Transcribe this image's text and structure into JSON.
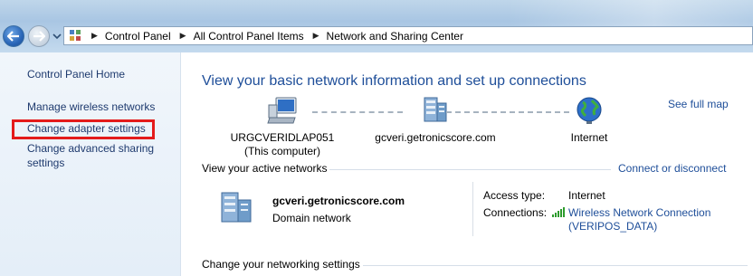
{
  "address_bar": {
    "breadcrumbs": [
      "Control Panel",
      "All Control Panel Items",
      "Network and Sharing Center"
    ],
    "separator": "▶"
  },
  "sidebar": {
    "home": "Control Panel Home",
    "items": [
      {
        "label": "Manage wireless networks"
      },
      {
        "label": "Change adapter settings"
      },
      {
        "label": "Change advanced sharing settings"
      }
    ]
  },
  "main": {
    "heading": "View your basic network information and set up connections",
    "see_full_map": "See full map",
    "map_nodes": [
      {
        "line1": "URGCVERIDLAP051",
        "line2": "(This computer)",
        "icon": "computer-icon"
      },
      {
        "line1": "gcveri.getronicscore.com",
        "line2": "",
        "icon": "network-icon"
      },
      {
        "line1": "Internet",
        "line2": "",
        "icon": "globe-icon"
      }
    ],
    "active_networks_title": "View your active networks",
    "connect_disconnect": "Connect or disconnect",
    "network": {
      "name": "gcveri.getronicscore.com",
      "type": "Domain network",
      "access_type_label": "Access type:",
      "access_type_value": "Internet",
      "connections_label": "Connections:",
      "connection_line1": "Wireless Network Connection",
      "connection_line2": "(VERIPOS_DATA)"
    },
    "change_settings_title": "Change your networking settings"
  },
  "colors": {
    "link": "#1e4e99",
    "highlight": "#e41b1b",
    "titlebar": "#a9c6e3"
  }
}
